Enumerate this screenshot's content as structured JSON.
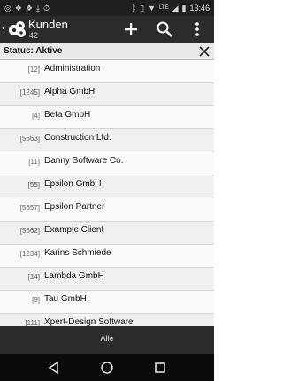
{
  "status_bar": {
    "time": "13:46",
    "network": "LTE",
    "left_icons": [
      "whatsapp-icon",
      "dropbox-icon",
      "dropbox-icon",
      "download-icon",
      "timer-icon"
    ],
    "right_icons": [
      "bluetooth-icon",
      "vibrate-icon",
      "wifi-icon",
      "signal-icon",
      "signal-icon",
      "battery-icon"
    ]
  },
  "appbar": {
    "title": "Kunden",
    "count": "42",
    "back_icon": "back-chevron-icon",
    "logo_icon": "app-logo-icon",
    "actions": [
      "add-icon",
      "search-icon",
      "more-icon"
    ]
  },
  "filter": {
    "label": "Status: Aktive",
    "close_icon": "close-icon"
  },
  "customers": [
    {
      "id": "[12]",
      "name": "Administration"
    },
    {
      "id": "[1245]",
      "name": "Alpha GmbH"
    },
    {
      "id": "[4]",
      "name": "Beta GmbH"
    },
    {
      "id": "[5663]",
      "name": "Construction Ltd."
    },
    {
      "id": "[11]",
      "name": "Danny Software Co."
    },
    {
      "id": "[55]",
      "name": "Epsilon GmbH"
    },
    {
      "id": "[5657]",
      "name": "Epsilon Partner"
    },
    {
      "id": "[5662]",
      "name": "Example Client"
    },
    {
      "id": "[1234]",
      "name": "Karins Schmiede"
    },
    {
      "id": "[14]",
      "name": "Lambda GmbH"
    },
    {
      "id": "[9]",
      "name": "Tau GmbH"
    },
    {
      "id": "[111]",
      "name": "Xpert-Design Software"
    }
  ],
  "bottom": {
    "all_label": "Alle"
  },
  "navbar": {
    "icons": [
      "nav-back-icon",
      "nav-home-icon",
      "nav-recents-icon"
    ]
  }
}
